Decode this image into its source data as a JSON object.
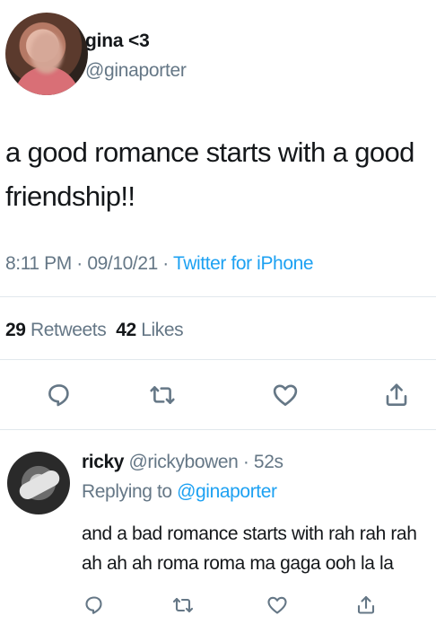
{
  "tweet": {
    "display_name": "gina <3",
    "handle": "@ginaporter",
    "text": "a good romance starts with a good friendship!!",
    "time": "8:11 PM",
    "date": "09/10/21",
    "source": "Twitter for iPhone",
    "retweets_count": "29",
    "retweets_label": "Retweets",
    "likes_count": "42",
    "likes_label": "Likes"
  },
  "reply": {
    "display_name": "ricky",
    "handle": "@rickybowen",
    "age": "52s",
    "replying_prefix": "Replying to",
    "replying_to": "@ginaporter",
    "text_line1": "and a bad romance starts with rah rah rah",
    "text_line2": "ah ah ah roma roma ma gaga ooh la la"
  },
  "icons": {
    "reply": "reply-icon",
    "retweet": "retweet-icon",
    "like": "heart-icon",
    "share": "share-icon"
  },
  "colors": {
    "link": "#1da1f2",
    "secondary_text": "#657786",
    "primary_text": "#14171a"
  }
}
